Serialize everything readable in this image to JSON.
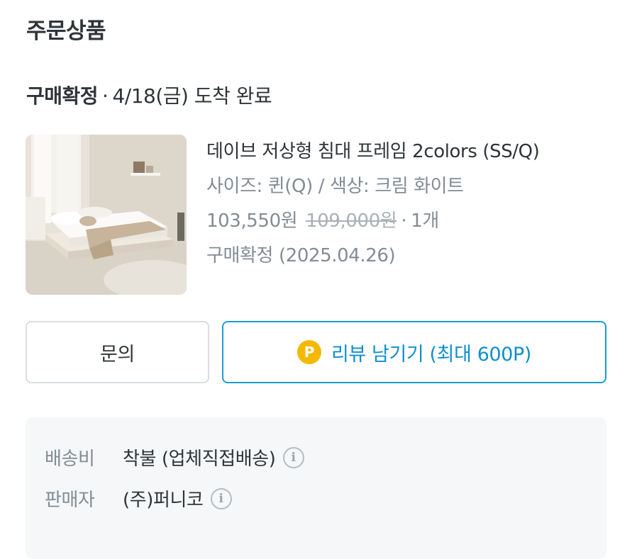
{
  "section": {
    "title": "주문상품"
  },
  "order_status": {
    "status": "구매확정",
    "separator": "·",
    "detail": "4/18(금) 도착 완료"
  },
  "product": {
    "image_alt": "저상형 침대 프레임 사진",
    "name": "데이브 저상형 침대 프레임 2colors (SS/Q)",
    "option": "사이즈: 퀸(Q) / 색상: 크림 화이트",
    "price": "103,550원",
    "original_price": "109,000원",
    "quantity_separator": "·",
    "quantity": "1개",
    "confirm": "구매확정 (2025.04.26)"
  },
  "actions": {
    "inquiry_label": "문의",
    "review_coin": "P",
    "review_label": "리뷰 남기기 (최대 600P)"
  },
  "info": {
    "shipping_label": "배송비",
    "shipping_value": "착불 (업체직접배송)",
    "seller_label": "판매자",
    "seller_value": "(주)퍼니코",
    "info_glyph": "i"
  },
  "colors": {
    "accent": "#0f8fcc",
    "coin": "#f5b800",
    "muted_text": "#828c94",
    "info_bg": "#f5f7f8"
  }
}
